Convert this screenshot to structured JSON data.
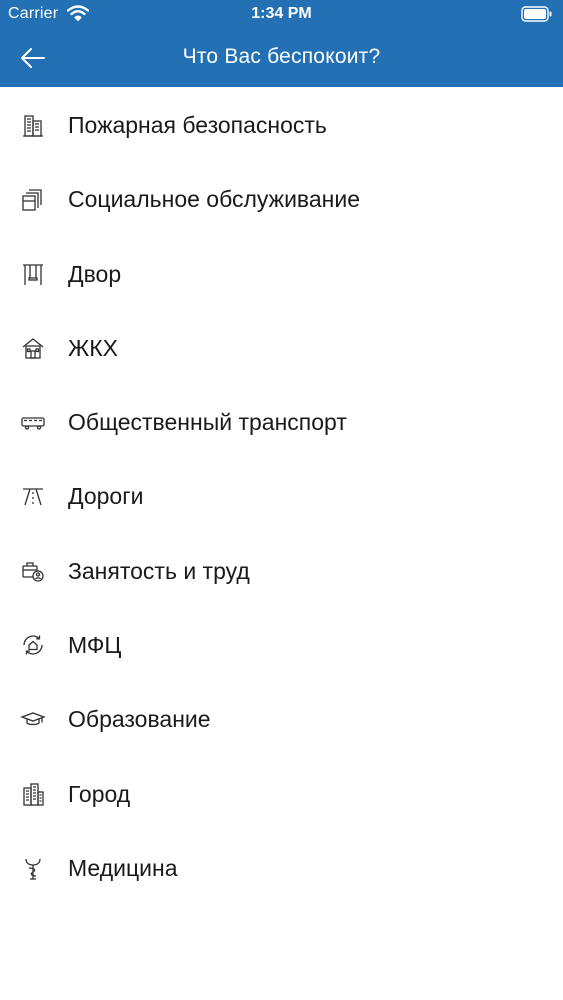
{
  "status_bar": {
    "carrier": "Carrier",
    "time": "1:34 PM"
  },
  "nav": {
    "title": "Что Вас беспокоит?",
    "back_icon": "arrow-left-icon"
  },
  "colors": {
    "appbar": "#2370b5",
    "text": "#1a1a1a",
    "icon": "#333333"
  },
  "items": [
    {
      "label": "Пожарная безопасность",
      "icon": "building-icon"
    },
    {
      "label": "Социальное обслуживание",
      "icon": "documents-icon"
    },
    {
      "label": "Двор",
      "icon": "swing-icon"
    },
    {
      "label": "ЖКХ",
      "icon": "house-icon"
    },
    {
      "label": "Общественный транспорт",
      "icon": "bus-icon"
    },
    {
      "label": "Дороги",
      "icon": "road-icon"
    },
    {
      "label": "Занятость и труд",
      "icon": "briefcase-person-icon"
    },
    {
      "label": "МФЦ",
      "icon": "circular-arrows-house-icon"
    },
    {
      "label": "Образование",
      "icon": "graduation-cap-icon"
    },
    {
      "label": "Город",
      "icon": "city-buildings-icon"
    },
    {
      "label": "Медицина",
      "icon": "caduceus-icon"
    }
  ]
}
